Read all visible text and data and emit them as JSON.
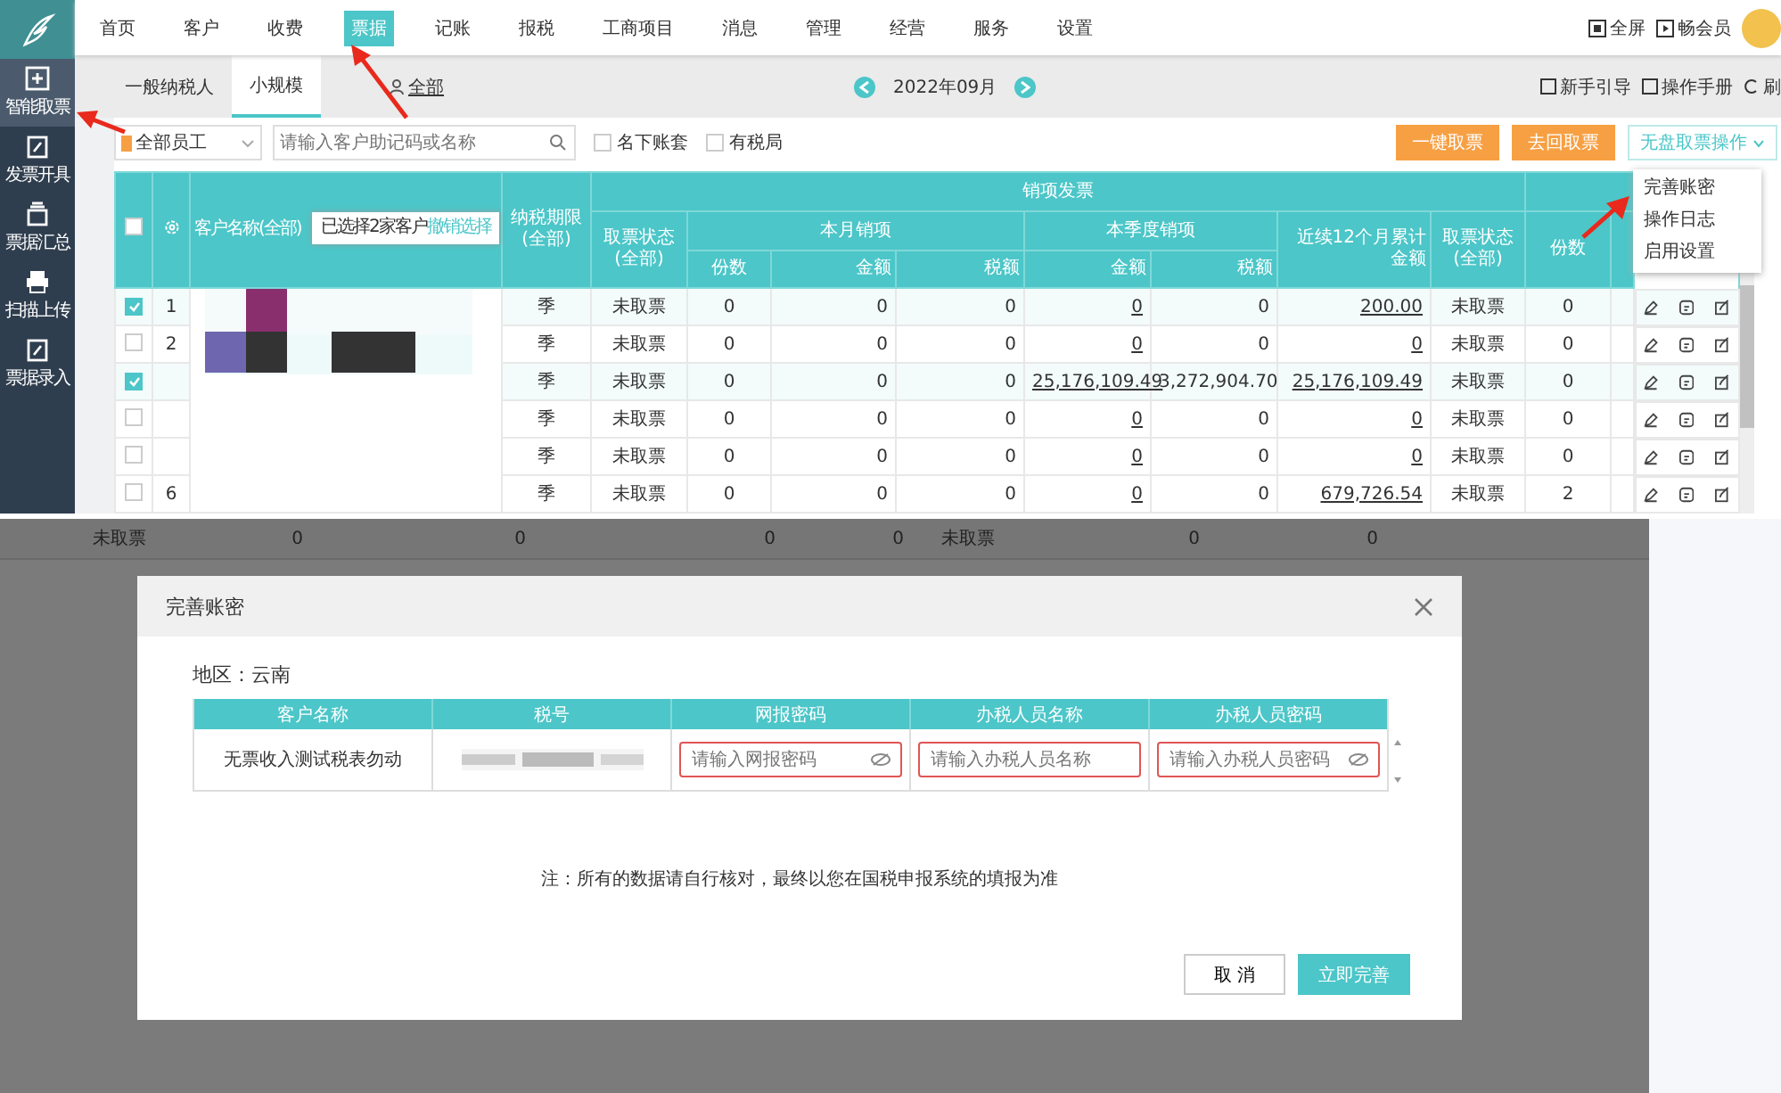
{
  "sidebar": {
    "items": [
      {
        "label": "智能取票",
        "selected": true
      },
      {
        "label": "发票开具",
        "selected": false
      },
      {
        "label": "票据汇总",
        "selected": false
      },
      {
        "label": "扫描上传",
        "selected": false
      },
      {
        "label": "票据录入",
        "selected": false
      }
    ]
  },
  "nav": {
    "items": [
      {
        "label": "首页",
        "selected": false
      },
      {
        "label": "客户",
        "selected": false
      },
      {
        "label": "收费",
        "selected": false
      },
      {
        "label": "票据",
        "selected": true
      },
      {
        "label": "记账",
        "selected": false
      },
      {
        "label": "报税",
        "selected": false
      },
      {
        "label": "工商项目",
        "selected": false
      },
      {
        "label": "消息",
        "selected": false
      },
      {
        "label": "管理",
        "selected": false
      },
      {
        "label": "经营",
        "selected": false
      },
      {
        "label": "服务",
        "selected": false
      },
      {
        "label": "设置",
        "selected": false
      }
    ],
    "right": [
      "全屏",
      "畅会员"
    ]
  },
  "tabs": [
    {
      "label": "一般纳税人",
      "selected": false
    },
    {
      "label": "小规模",
      "selected": true
    },
    {
      "label": "全部",
      "selected": false
    }
  ],
  "month": "2022年09月",
  "help_links": [
    "新手引导",
    "操作手册",
    "刷"
  ],
  "toolbar": {
    "staff": "全部员工",
    "search_placeholder": "请输入客户助记码或名称",
    "checks": [
      {
        "label": "名下账套",
        "checked": false
      },
      {
        "label": "有税局",
        "checked": false
      }
    ],
    "buttons": [
      "一键取票",
      "去回取票"
    ],
    "menu_button": "无盘取票操作"
  },
  "menu": {
    "items": [
      "完善账密",
      "操作日志",
      "启用设置"
    ]
  },
  "tooltip": {
    "text": "已选择2家客户",
    "link": "撤销选择"
  },
  "select_all": {
    "checked": false
  },
  "table": {
    "header": {
      "customer": "客户名称(全部)",
      "period": "纳税期限(全部)",
      "sales_group": "销项发票",
      "status": "取票状态(全部)",
      "month_group": "本月销项",
      "quarter_group": "本季度销项",
      "rolling": "近续12个月累计金额",
      "status2": "取票状态(全部)",
      "sub": [
        "份数",
        "金额",
        "税额",
        "金额",
        "税额"
      ],
      "count2": "份数"
    },
    "rows": [
      {
        "checked": true,
        "index": "1",
        "period": "季",
        "status": "未取票",
        "values": [
          "0",
          "0",
          "0",
          "0",
          "0",
          "200.00"
        ],
        "status2": "未取票",
        "count2": "0"
      },
      {
        "checked": false,
        "index": "2",
        "period": "季",
        "status": "未取票",
        "values": [
          "0",
          "0",
          "0",
          "0",
          "0",
          "0"
        ],
        "status2": "未取票",
        "count2": "0"
      },
      {
        "checked": true,
        "period": "季",
        "status": "未取票",
        "values": [
          "0",
          "0",
          "0",
          "25,176,109.49",
          "3,272,904.70",
          "25,176,109.49"
        ],
        "status2": "未取票",
        "count2": "0"
      },
      {
        "checked": false,
        "period": "季",
        "status": "未取票",
        "values": [
          "0",
          "0",
          "0",
          "0",
          "0",
          "0"
        ],
        "status2": "未取票",
        "count2": "0"
      },
      {
        "checked": false,
        "period": "季",
        "status": "未取票",
        "values": [
          "0",
          "0",
          "0",
          "0",
          "0",
          "0"
        ],
        "status2": "未取票",
        "count2": "0"
      },
      {
        "checked": false,
        "index": "6",
        "period": "季",
        "status": "未取票",
        "values": [
          "0",
          "0",
          "0",
          "0",
          "0",
          "679,726.54"
        ],
        "status2": "未取票",
        "count2": "2"
      }
    ]
  },
  "background_row": [
    "未取票",
    "0",
    "0",
    "0",
    "0",
    "未取票",
    "0",
    "0"
  ],
  "dialog": {
    "title": "完善账密",
    "region": "地区：云南",
    "columns": [
      "客户名称",
      "税号",
      "网报密码",
      "办税人员名称",
      "办税人员密码"
    ],
    "row": {
      "name": "无票收入测试税表勿动",
      "fields": [
        {
          "placeholder": "请输入网报密码",
          "kind": "password"
        },
        {
          "placeholder": "请输入办税人员名称",
          "kind": "text"
        },
        {
          "placeholder": "请输入办税人员密码",
          "kind": "password"
        }
      ]
    },
    "note": "注：所有的数据请自行核对，最终以您在国税申报系统的填报为准",
    "buttons": [
      {
        "label": "取 消",
        "kind": "secondary"
      },
      {
        "label": "立即完善",
        "kind": "primary"
      }
    ]
  }
}
